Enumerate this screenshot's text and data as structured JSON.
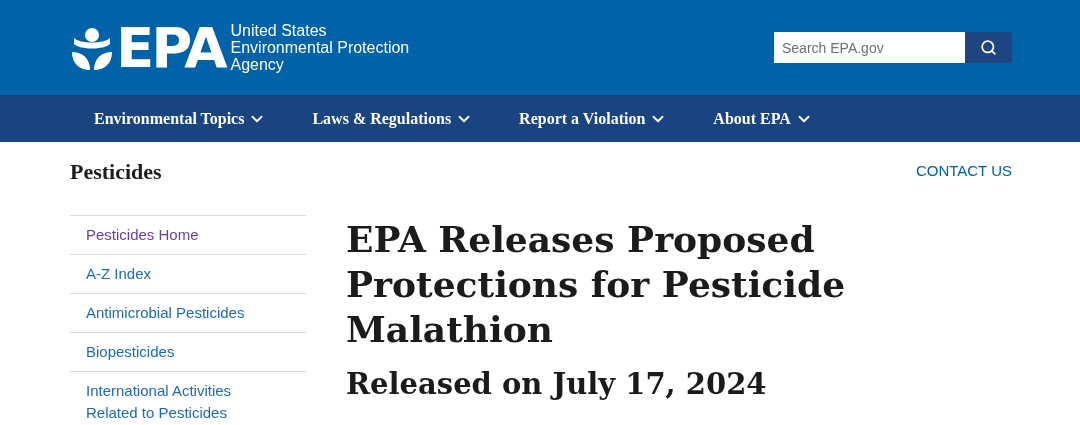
{
  "header": {
    "logo_text": "EPA",
    "agency_lines": [
      "United States",
      "Environmental Protection",
      "Agency"
    ],
    "search": {
      "placeholder": "Search EPA.gov"
    }
  },
  "nav": [
    {
      "label": "Environmental Topics"
    },
    {
      "label": "Laws & Regulations"
    },
    {
      "label": "Report a Violation"
    },
    {
      "label": "About EPA"
    }
  ],
  "section_title": "Pesticides",
  "contact_link": "CONTACT US",
  "sidebar": {
    "items": [
      {
        "label": "Pesticides Home",
        "visited": true
      },
      {
        "label": "A-Z Index",
        "visited": false
      },
      {
        "label": "Antimicrobial Pesticides",
        "visited": false
      },
      {
        "label": "Biopesticides",
        "visited": false
      },
      {
        "label": "International Activities Related to Pesticides",
        "visited": false
      }
    ]
  },
  "article": {
    "title": "EPA Releases Proposed Protections for Pesticide Malathion",
    "subtitle": "Released on July 17, 2024"
  }
}
